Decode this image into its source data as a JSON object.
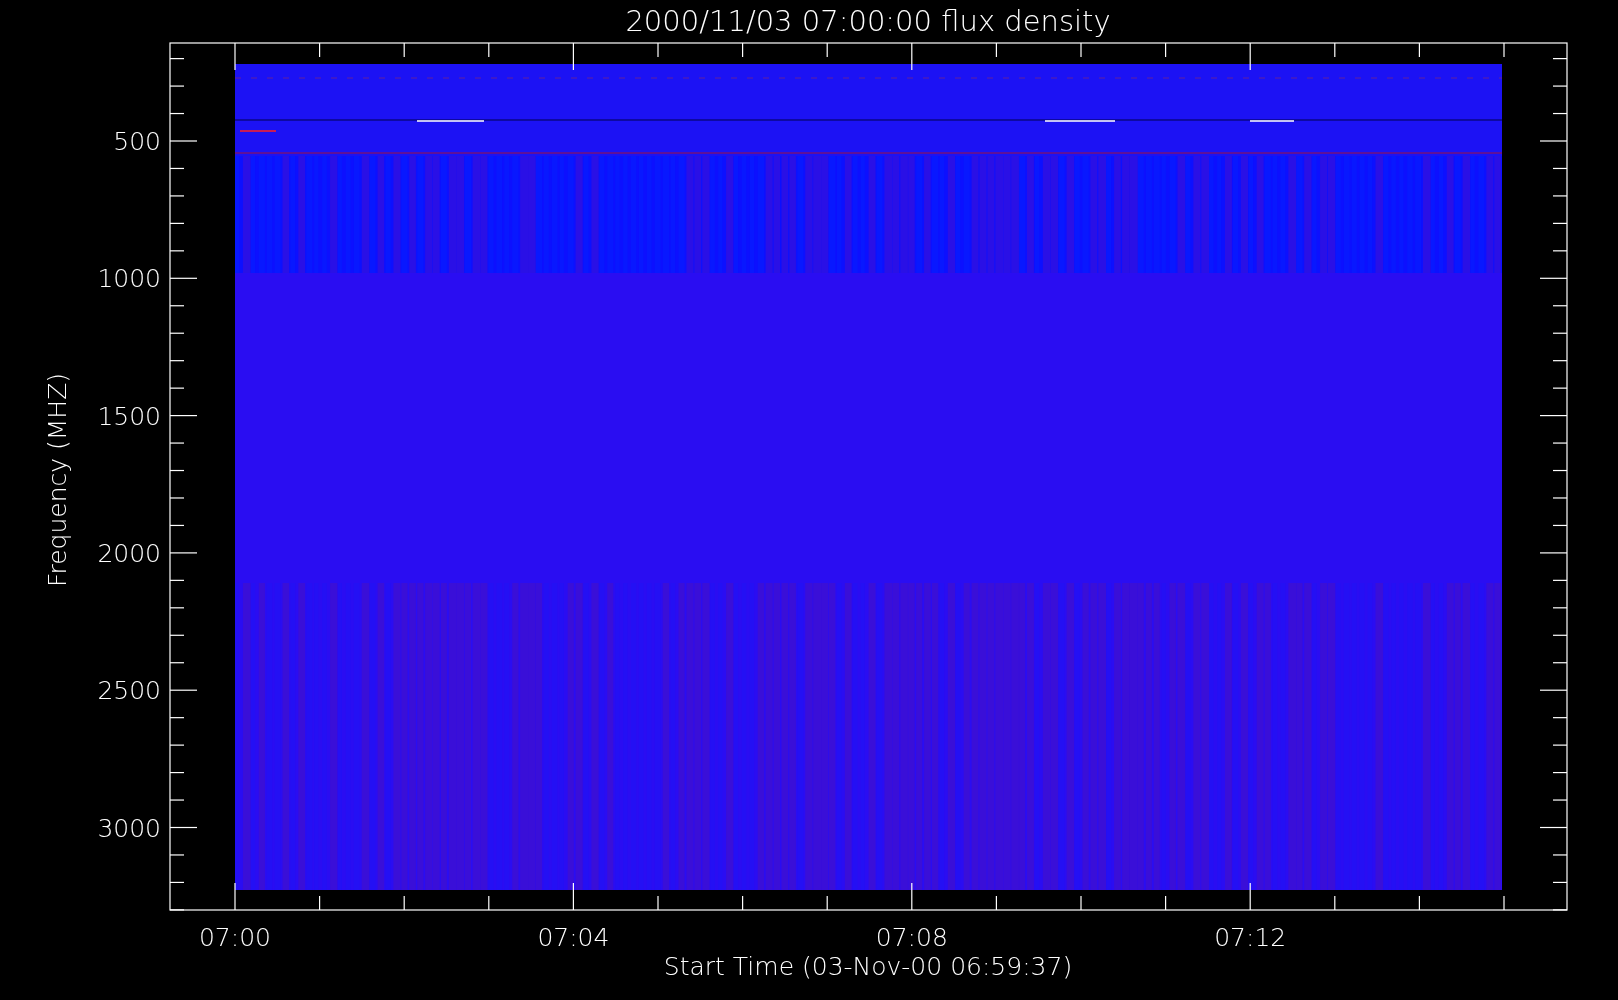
{
  "title": "2000/11/03 07:00:00 flux density",
  "y_axis": {
    "label": "Frequency (MHZ)",
    "ticks": [
      "500",
      "1000",
      "1500",
      "2000",
      "2500",
      "3000"
    ]
  },
  "x_axis": {
    "label": "Start Time (03-Nov-00 06:59:37)",
    "ticks": [
      "07:00",
      "07:04",
      "07:08",
      "07:12"
    ]
  }
}
